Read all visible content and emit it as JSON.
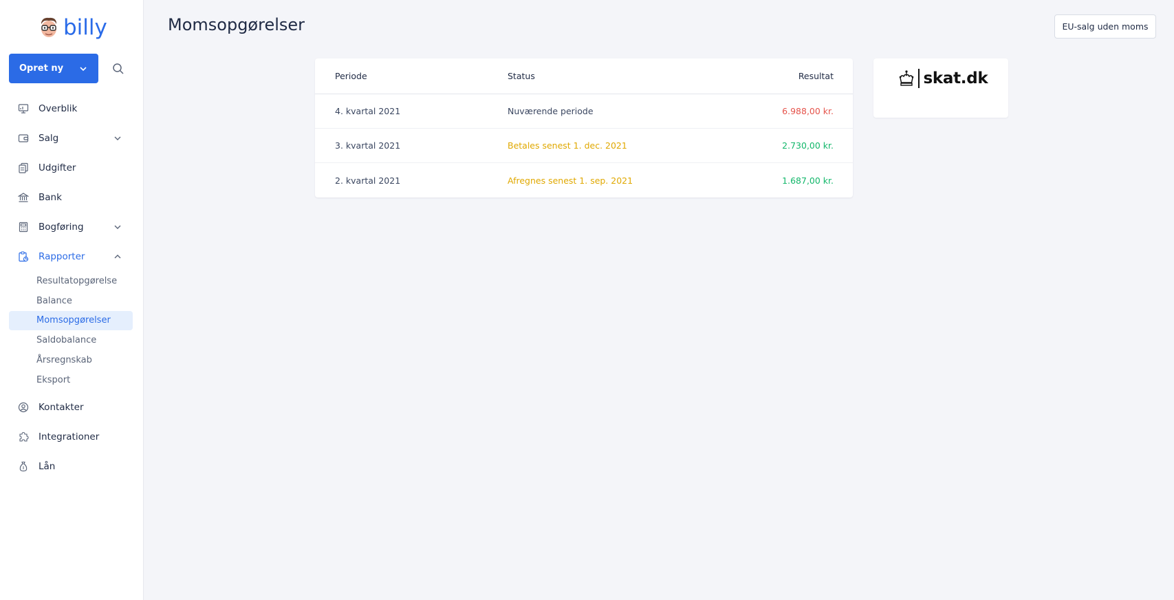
{
  "app": {
    "logo_text": "billy"
  },
  "sidebar": {
    "create_label": "Opret ny",
    "nav": [
      {
        "label": "Overblik"
      },
      {
        "label": "Salg"
      },
      {
        "label": "Udgifter"
      },
      {
        "label": "Bank"
      },
      {
        "label": "Bogføring"
      },
      {
        "label": "Rapporter"
      },
      {
        "label": "Kontakter"
      },
      {
        "label": "Integrationer"
      },
      {
        "label": "Lån"
      }
    ],
    "reports_sub": [
      {
        "label": "Resultatopgørelse"
      },
      {
        "label": "Balance"
      },
      {
        "label": "Momsopgørelser"
      },
      {
        "label": "Saldobalance"
      },
      {
        "label": "Årsregnskab"
      },
      {
        "label": "Eksport"
      }
    ]
  },
  "header": {
    "title": "Momsopgørelser",
    "eu_button": "EU-salg uden moms"
  },
  "table": {
    "columns": {
      "period": "Periode",
      "status": "Status",
      "result": "Resultat"
    },
    "rows": [
      {
        "period": "4. kvartal 2021",
        "status": "Nuværende periode",
        "result": "6.988,00 kr."
      },
      {
        "period": "3. kvartal 2021",
        "status": "Betales senest 1. dec. 2021",
        "result": "2.730,00 kr."
      },
      {
        "period": "2. kvartal 2021",
        "status": "Afregnes senest 1. sep. 2021",
        "result": "1.687,00 kr."
      }
    ]
  },
  "skat": {
    "logo_text": "skat.dk"
  },
  "colors": {
    "accent": "#2b6be6",
    "status_current": "#3a4660",
    "status_due": "#e0a800",
    "result_negative": "#e5534b",
    "result_positive": "#12b76a"
  }
}
